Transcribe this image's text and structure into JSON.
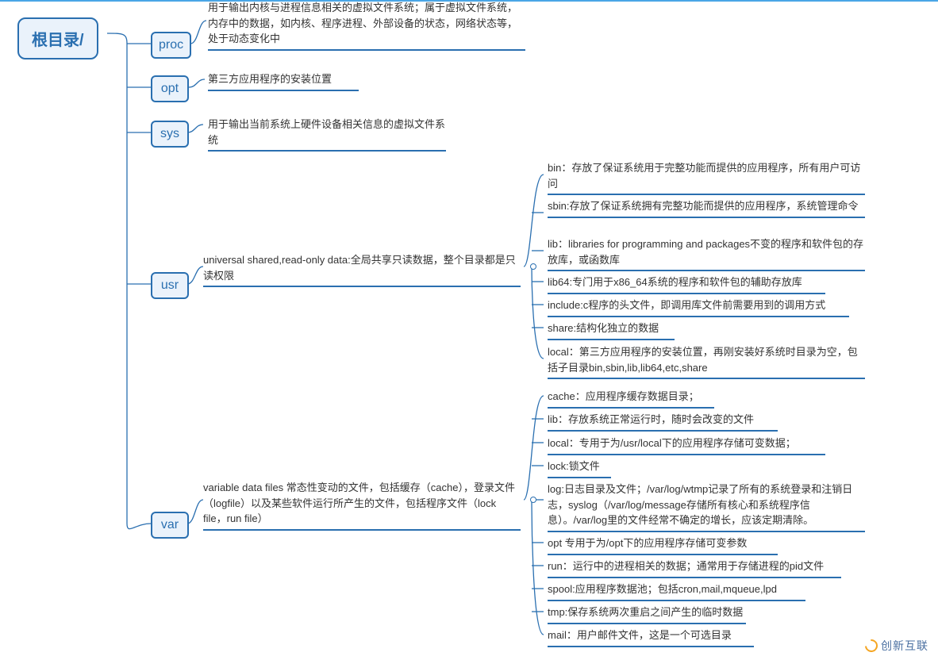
{
  "root": {
    "label": "根目录/"
  },
  "dirs": {
    "proc": {
      "label": "proc",
      "desc": "用于输出内核与进程信息相关的虚拟文件系统；属于虚拟文件系统，内存中的数据，如内核、程序进程、外部设备的状态，网络状态等，处于动态变化中"
    },
    "opt": {
      "label": "opt",
      "desc": "第三方应用程序的安装位置"
    },
    "sys": {
      "label": "sys",
      "desc": "用于输出当前系统上硬件设备相关信息的虚拟文件系统"
    },
    "usr": {
      "label": "usr",
      "desc": "universal shared,read-only data:全局共享只读数据，整个目录都是只读权限"
    },
    "var": {
      "label": "var",
      "desc": "variable data files 常态性变动的文件，包括缓存（cache），登录文件（logfile）以及某些软件运行所产生的文件，包括程序文件（lock file，run file）"
    }
  },
  "usr_children": [
    "bin：存放了保证系统用于完整功能而提供的应用程序，所有用户可访问",
    "sbin:存放了保证系统拥有完整功能而提供的应用程序，系统管理命令",
    "lib：libraries for programming and packages不变的程序和软件包的存放库，或函数库",
    "lib64:专门用于x86_64系统的程序和软件包的辅助存放库",
    "include:c程序的头文件，即调用库文件前需要用到的调用方式",
    "share:结构化独立的数据",
    "local：第三方应用程序的安装位置，再刚安装好系统时目录为空，包括子目录bin,sbin,lib,lib64,etc,share"
  ],
  "var_children": [
    "cache：应用程序缓存数据目录；",
    "lib：存放系统正常运行时，随时会改变的文件",
    "local：专用于为/usr/local下的应用程序存储可变数据；",
    "lock:锁文件",
    "log:日志目录及文件；/var/log/wtmp记录了所有的系统登录和注销日志，syslog（/var/log/message存储所有核心和系统程序信息）。/var/log里的文件经常不确定的增长，应该定期清除。",
    "opt 专用于为/opt下的应用程序存储可变参数",
    "run：运行中的进程相关的数据；通常用于存储进程的pid文件",
    "spool:应用程序数据池；包括cron,mail,mqueue,lpd",
    "tmp:保存系统两次重启之间产生的临时数据",
    "mail：用户邮件文件，这是一个可选目录"
  ],
  "watermark": "创新互联"
}
